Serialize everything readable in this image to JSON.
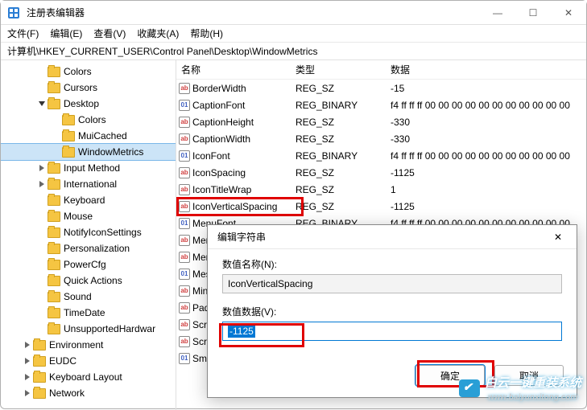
{
  "window": {
    "title": "注册表编辑器",
    "min": "—",
    "max": "☐",
    "close": "✕"
  },
  "menu": {
    "file": "文件(F)",
    "edit": "编辑(E)",
    "view": "查看(V)",
    "favorites": "收藏夹(A)",
    "help": "帮助(H)"
  },
  "address": "计算机\\HKEY_CURRENT_USER\\Control Panel\\Desktop\\WindowMetrics",
  "tree": {
    "items": [
      {
        "depth": 2,
        "caret": "",
        "label": "Colors"
      },
      {
        "depth": 2,
        "caret": "",
        "label": "Cursors"
      },
      {
        "depth": 2,
        "caret": "v",
        "label": "Desktop"
      },
      {
        "depth": 3,
        "caret": "",
        "label": "Colors"
      },
      {
        "depth": 3,
        "caret": "",
        "label": "MuiCached"
      },
      {
        "depth": 3,
        "caret": "",
        "label": "WindowMetrics",
        "sel": true
      },
      {
        "depth": 2,
        "caret": ">",
        "label": "Input Method"
      },
      {
        "depth": 2,
        "caret": ">",
        "label": "International"
      },
      {
        "depth": 2,
        "caret": "",
        "label": "Keyboard"
      },
      {
        "depth": 2,
        "caret": "",
        "label": "Mouse"
      },
      {
        "depth": 2,
        "caret": "",
        "label": "NotifyIconSettings"
      },
      {
        "depth": 2,
        "caret": "",
        "label": "Personalization"
      },
      {
        "depth": 2,
        "caret": "",
        "label": "PowerCfg"
      },
      {
        "depth": 2,
        "caret": "",
        "label": "Quick Actions"
      },
      {
        "depth": 2,
        "caret": "",
        "label": "Sound"
      },
      {
        "depth": 2,
        "caret": "",
        "label": "TimeDate"
      },
      {
        "depth": 2,
        "caret": "",
        "label": "UnsupportedHardwar"
      },
      {
        "depth": 1,
        "caret": ">",
        "label": "Environment"
      },
      {
        "depth": 1,
        "caret": ">",
        "label": "EUDC"
      },
      {
        "depth": 1,
        "caret": ">",
        "label": "Keyboard Layout"
      },
      {
        "depth": 1,
        "caret": ">",
        "label": "Network"
      }
    ]
  },
  "columns": {
    "name": "名称",
    "type": "类型",
    "data": "数据"
  },
  "values": [
    {
      "icon": "sz",
      "name": "BorderWidth",
      "type": "REG_SZ",
      "data": "-15"
    },
    {
      "icon": "bin",
      "name": "CaptionFont",
      "type": "REG_BINARY",
      "data": "f4 ff ff ff 00 00 00 00 00 00 00 00 00 00 00"
    },
    {
      "icon": "sz",
      "name": "CaptionHeight",
      "type": "REG_SZ",
      "data": "-330"
    },
    {
      "icon": "sz",
      "name": "CaptionWidth",
      "type": "REG_SZ",
      "data": "-330"
    },
    {
      "icon": "bin",
      "name": "IconFont",
      "type": "REG_BINARY",
      "data": "f4 ff ff ff 00 00 00 00 00 00 00 00 00 00 00"
    },
    {
      "icon": "sz",
      "name": "IconSpacing",
      "type": "REG_SZ",
      "data": "-1125"
    },
    {
      "icon": "sz",
      "name": "IconTitleWrap",
      "type": "REG_SZ",
      "data": "1"
    },
    {
      "icon": "sz",
      "name": "IconVerticalSpacing",
      "type": "REG_SZ",
      "data": "-1125"
    },
    {
      "icon": "bin",
      "name": "MenuFont",
      "type": "REG_BINARY",
      "data": "f4 ff ff ff 00 00 00 00 00 00 00 00 00 00 00"
    },
    {
      "icon": "sz",
      "name": "Menu",
      "type": "",
      "data": ""
    },
    {
      "icon": "sz",
      "name": "Menu",
      "type": "",
      "data": ""
    },
    {
      "icon": "bin",
      "name": "Mes",
      "type": "",
      "data": ""
    },
    {
      "icon": "sz",
      "name": "Min",
      "type": "",
      "data": ""
    },
    {
      "icon": "sz",
      "name": "Pad",
      "type": "",
      "data": ""
    },
    {
      "icon": "sz",
      "name": "Scro",
      "type": "",
      "data": ""
    },
    {
      "icon": "sz",
      "name": "Scro",
      "type": "",
      "data": ""
    },
    {
      "icon": "bin",
      "name": "SmC",
      "type": "",
      "data": ""
    }
  ],
  "dialog": {
    "title": "编辑字符串",
    "close": "✕",
    "name_label": "数值名称(N):",
    "name_value": "IconVerticalSpacing",
    "data_label": "数值数据(V):",
    "data_value": "-1125",
    "ok": "确定",
    "cancel": "取消"
  },
  "watermark": {
    "main": "白云一键重装系统",
    "sub": "www.baiyunxitong.com"
  }
}
